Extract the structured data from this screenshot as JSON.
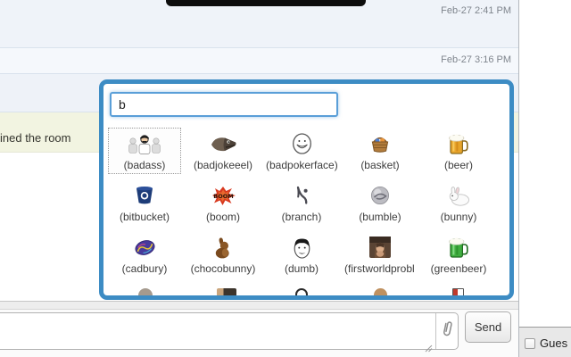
{
  "chat": {
    "timestamps": [
      "Feb-27 2:41 PM",
      "Feb-27 3:16 PM"
    ],
    "system_message": "ined the room"
  },
  "emoticon_picker": {
    "search_value": "b",
    "items": [
      {
        "label": "(badass)",
        "icon": "badass-icon",
        "selected": true
      },
      {
        "label": "(badjokeeel)",
        "icon": "badjokeeel-icon",
        "selected": false
      },
      {
        "label": "(badpokerface)",
        "icon": "badpokerface-icon",
        "selected": false
      },
      {
        "label": "(basket)",
        "icon": "basket-icon",
        "selected": false
      },
      {
        "label": "(beer)",
        "icon": "beer-icon",
        "selected": false
      },
      {
        "label": "(bitbucket)",
        "icon": "bitbucket-icon",
        "selected": false
      },
      {
        "label": "(boom)",
        "icon": "boom-icon",
        "selected": false
      },
      {
        "label": "(branch)",
        "icon": "branch-icon",
        "selected": false
      },
      {
        "label": "(bumble)",
        "icon": "bumble-icon",
        "selected": false
      },
      {
        "label": "(bunny)",
        "icon": "bunny-icon",
        "selected": false
      },
      {
        "label": "(cadbury)",
        "icon": "cadbury-icon",
        "selected": false
      },
      {
        "label": "(chocobunny)",
        "icon": "chocobunny-icon",
        "selected": false
      },
      {
        "label": "(dumb)",
        "icon": "dumb-icon",
        "selected": false
      },
      {
        "label": "(firstworldprobl",
        "icon": "firstworldproblems-icon",
        "selected": false
      },
      {
        "label": "(greenbeer)",
        "icon": "greenbeer-icon",
        "selected": false
      }
    ],
    "partial_next_row_icon_count": 5
  },
  "composer": {
    "message_value": "",
    "send_label": "Send"
  },
  "sidebar": {
    "guest_label": "Gues",
    "guest_checked": false
  },
  "colors": {
    "popup_border": "#3d8cc4",
    "search_focus_border": "#5a9fd8",
    "system_row_bg": "#f2f4e1",
    "chat_row_bg": "#eff3f9",
    "timestamp_text": "#7f858d"
  }
}
